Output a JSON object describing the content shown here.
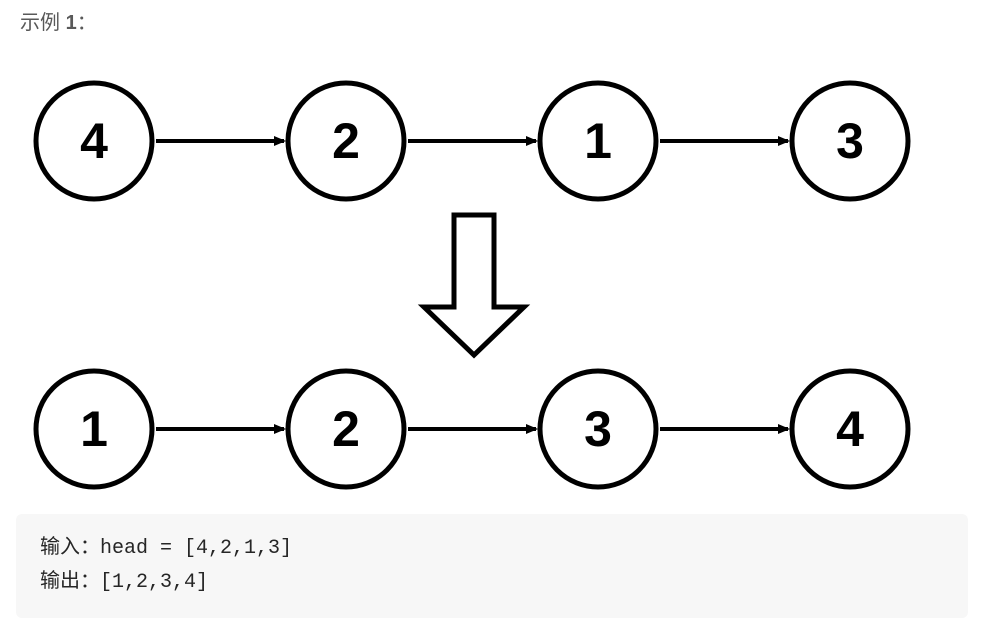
{
  "title_prefix": "示例 ",
  "title_number": "1",
  "title_suffix": "：",
  "chart_data": {
    "type": "diagram",
    "description": "Linked list sorting example: unsorted list transforms into sorted list",
    "input_list": [
      4,
      2,
      1,
      3
    ],
    "output_list": [
      1,
      2,
      3,
      4
    ]
  },
  "code": {
    "input_label": "输入：",
    "input_text": "head = [4,2,1,3]",
    "output_label": "输出：",
    "output_text": "[1,2,3,4]"
  }
}
